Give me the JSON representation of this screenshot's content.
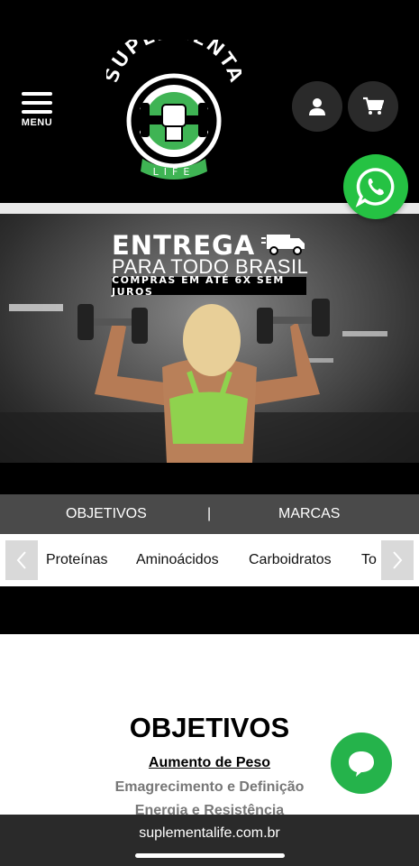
{
  "header": {
    "menu_label": "MENU",
    "logo_text_top": "SUPLEMENTA",
    "logo_text_bottom": "LIFE"
  },
  "banner": {
    "headline": "ENTREGA",
    "subheadline": "PARA TODO BRASIL",
    "badge": "COMPRAS EM ATÉ 6X SEM JUROS"
  },
  "nav": {
    "objetivos": "OBJETIVOS",
    "separator": "|",
    "marcas": "MARCAS"
  },
  "categories": [
    "Proteínas",
    "Aminoácidos",
    "Carboidratos",
    "To"
  ],
  "section": {
    "title": "OBJETIVOS",
    "links": [
      "Aumento de Peso",
      "Emagrecimento e Definição",
      "Energia e Resistência"
    ]
  },
  "browser": {
    "url": "suplementalife.com.br"
  },
  "colors": {
    "brand_green": "#3fb454",
    "whatsapp_green": "#25c243",
    "nav_bg": "#4a4a4a"
  },
  "icons": {
    "menu": "hamburger-icon",
    "user": "user-icon",
    "cart": "cart-icon",
    "whatsapp": "whatsapp-icon",
    "chat": "chat-icon",
    "prev": "chevron-left-icon",
    "next": "chevron-right-icon",
    "truck": "truck-icon"
  }
}
